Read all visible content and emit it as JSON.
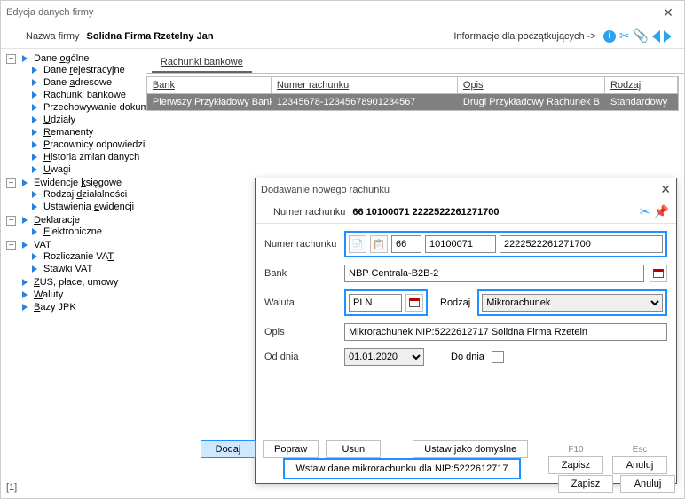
{
  "window": {
    "title": "Edycja danych firmy"
  },
  "header": {
    "name_label": "Nazwa firmy",
    "name_value": "Solidna Firma Rzetelny Jan",
    "help_link": "Informacje dla początkujących ->"
  },
  "tree": {
    "general": {
      "label": "Dane ogólne",
      "items": [
        "Dane rejestracyjne",
        "Dane adresowe",
        "Rachunki bankowe",
        "Przechowywanie dokumentacji",
        "Udziały",
        "Remanenty",
        "Pracownicy odpowiedzialni",
        "Historia zmian danych",
        "Uwagi"
      ],
      "accel": [
        "r",
        "a",
        "b",
        "",
        "U",
        "R",
        "P",
        "H",
        "U"
      ]
    },
    "ledger": {
      "label": "Ewidencje księgowe",
      "items": [
        "Rodzaj działalności",
        "Ustawienia ewidencji"
      ],
      "accel": [
        "d",
        "e"
      ]
    },
    "decl": {
      "label": "Deklaracje",
      "items": [
        "Elektroniczne"
      ],
      "accel": [
        "E"
      ]
    },
    "vat": {
      "label": "VAT",
      "items": [
        "Rozliczanie VAT",
        "Stawki VAT"
      ],
      "accel": [
        "VAT",
        "S"
      ]
    },
    "roots": [
      "ZUS, płace, umowy",
      "Waluty",
      "Bazy JPK"
    ],
    "roots_accel": [
      "Z",
      "W",
      "B"
    ]
  },
  "tab": {
    "label": "Rachunki bankowe"
  },
  "grid": {
    "cols": [
      "Bank",
      "Numer rachunku",
      "Opis",
      "Rodzaj"
    ],
    "row": {
      "bank": "Pierwszy Przykładowy Bank",
      "num": "12345678-12345678901234567",
      "desc": "Drugi Przykładowy Rachunek B",
      "type": "Standardowy"
    }
  },
  "dialog": {
    "title": "Dodawanie nowego rachunku",
    "header_label": "Numer rachunku",
    "header_value": "66 10100071 2222522261271700",
    "numer_label": "Numer rachunku",
    "num1": "66",
    "num2": "10100071",
    "num3": "2222522261271700",
    "bank_label": "Bank",
    "bank_value": "NBP Centrala-B2B-2",
    "waluta_label": "Waluta",
    "waluta_value": "PLN",
    "rodzaj_label": "Rodzaj",
    "rodzaj_value": "Mikrorachunek",
    "opis_label": "Opis",
    "opis_value": "Mikrorachunek NIP:5222612717 Solidna Firma Rzeteln",
    "od_label": "Od dnia",
    "od_value": "01.01.2020",
    "do_label": "Do dnia",
    "insert_label": "Wstaw dane mikrorachunku dla NIP:5222612717",
    "key_f10": "F10",
    "key_esc": "Esc",
    "btn_save": "Zapisz",
    "btn_cancel": "Anuluj"
  },
  "buttons": {
    "add": "Dodaj",
    "edit": "Popraw",
    "del": "Usun",
    "default": "Ustaw jako domyslne",
    "save": "Zapisz",
    "cancel": "Anuluj"
  },
  "status": "[1]"
}
